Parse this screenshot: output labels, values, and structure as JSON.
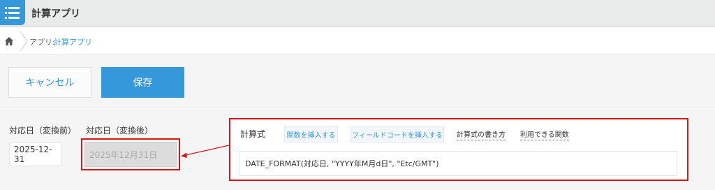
{
  "header": {
    "app_title": "計算アプリ",
    "app_icon": "list-icon"
  },
  "breadcrumb": {
    "home_icon": "home-icon",
    "prefix": "アプリ:",
    "app_link": "計算アプリ"
  },
  "toolbar": {
    "cancel_label": "キャンセル",
    "save_label": "保存"
  },
  "fields": {
    "before": {
      "label": "対応日（変換前）",
      "value": "2025-12-31"
    },
    "after": {
      "label": "対応日（変換後）",
      "value": "2025年12月31日"
    }
  },
  "formula": {
    "label": "計算式",
    "insert_function": "関数を挿入する",
    "insert_field_code": "フィールドコードを挿入する",
    "how_to_write": "計算式の書き方",
    "available_functions": "利用できる関数",
    "value": "DATE_FORMAT(対応日, \"YYYY年M月d日\", \"Etc/GMT\")"
  },
  "colors": {
    "accent": "#3498db",
    "highlight": "#d9151c"
  }
}
